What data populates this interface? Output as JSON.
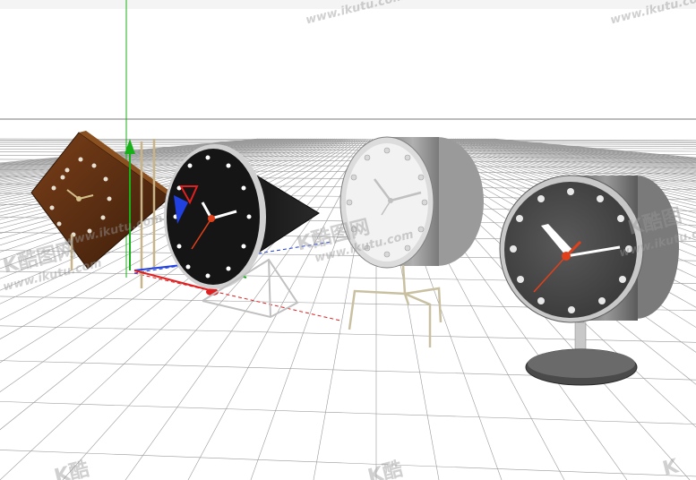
{
  "viewport": {
    "background": "#ffffff",
    "grid_color": "#9a9a9a",
    "horizon_color": "#7a7a7a",
    "axis_colors": {
      "x": "#e02020",
      "y": "#18b018",
      "z": "#2040e0"
    }
  },
  "objects": [
    {
      "name": "wooden-tilted-clock",
      "face": "#5a2e12",
      "hands": "#d4c08a"
    },
    {
      "name": "cone-clock",
      "face": "#151515",
      "hands": "#ffffff",
      "second_hand": "#e0401a"
    },
    {
      "name": "white-drum-clock-on-legs",
      "face": "#f2f2f2",
      "hands": "#c8c8c8"
    },
    {
      "name": "gray-drum-clock-on-pedestal",
      "face": "#4a4a4a",
      "hands": "#ffffff",
      "second_hand": "#e0401a"
    }
  ],
  "watermark": {
    "url": "www.ikutu.com"
  }
}
